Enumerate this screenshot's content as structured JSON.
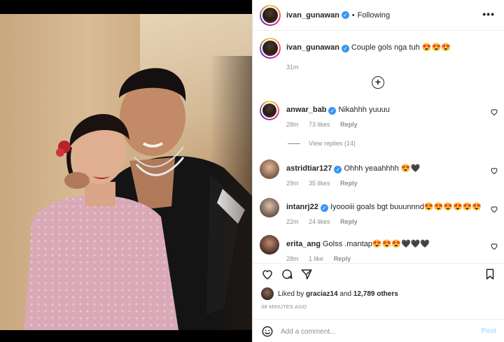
{
  "post": {
    "username": "ivan_gunawan",
    "following_label": "Following",
    "caption_body": "Couple gols nga tuh 😍😍😍",
    "caption_time": "31m"
  },
  "comments": [
    {
      "username": "anwar_bab",
      "verified": true,
      "text": "Nikahhh yuuuu",
      "time": "28m",
      "likes": "73 likes",
      "reply": "Reply"
    },
    {
      "username": "astridtiar127",
      "verified": true,
      "text": "Ohhh yeaahhhh 😍🖤",
      "time": "29m",
      "likes": "35 likes",
      "reply": "Reply"
    },
    {
      "username": "intanrj22",
      "verified": true,
      "text": "Iyoooiii goals bgt buuunnnd😍😍😍😍😍😍",
      "time": "22m",
      "likes": "24 likes",
      "reply": "Reply"
    },
    {
      "username": "erita_ang",
      "verified": false,
      "text": "Golss .mantap😍😍😍🖤🖤🖤",
      "time": "28m",
      "likes": "1 like",
      "reply": "Reply"
    }
  ],
  "view_replies": "View replies (14)",
  "likes": {
    "prefix": "Liked by",
    "user": "graciaz14",
    "and": "and",
    "others": "12,789 others"
  },
  "time_ago": "38 MINUTES AGO",
  "comment_input": {
    "placeholder": "Add a comment...",
    "post_label": "Post"
  },
  "icons": [
    "more-icon",
    "plus-circle-icon",
    "heart-icon",
    "comment-icon",
    "share-icon",
    "bookmark-icon",
    "emoji-icon",
    "verified-icon"
  ],
  "colors": {
    "verified": "#3897f0",
    "meta": "#8e8e8e",
    "post_button": "#b2dffc"
  }
}
